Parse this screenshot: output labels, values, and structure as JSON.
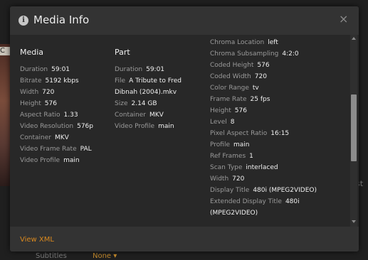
{
  "background": {
    "left_fragment": "C",
    "right_fragment": "st",
    "bottom_label": "Subtitles",
    "bottom_value": "None"
  },
  "modal": {
    "title": "Media Info",
    "icon": "info-icon",
    "close_glyph": "×",
    "footer_link": "View XML"
  },
  "media": {
    "title": "Media",
    "fields": [
      {
        "label": "Duration",
        "value": "59:01"
      },
      {
        "label": "Bitrate",
        "value": "5192 kbps"
      },
      {
        "label": "Width",
        "value": "720"
      },
      {
        "label": "Height",
        "value": "576"
      },
      {
        "label": "Aspect Ratio",
        "value": "1.33"
      },
      {
        "label": "Video Resolution",
        "value": "576p"
      },
      {
        "label": "Container",
        "value": "MKV"
      },
      {
        "label": "Video Frame Rate",
        "value": "PAL"
      },
      {
        "label": "Video Profile",
        "value": "main"
      }
    ]
  },
  "part": {
    "title": "Part",
    "fields": [
      {
        "label": "Duration",
        "value": "59:01"
      },
      {
        "label": "File",
        "value": "A Tribute to Fred Dibnah (2004).mkv"
      },
      {
        "label": "Size",
        "value": "2.14 GB"
      },
      {
        "label": "Container",
        "value": "MKV"
      },
      {
        "label": "Video Profile",
        "value": "main"
      }
    ]
  },
  "stream": {
    "fields": [
      {
        "label": "Chroma Location",
        "value": "left"
      },
      {
        "label": "Chroma Subsampling",
        "value": "4:2:0"
      },
      {
        "label": "Coded Height",
        "value": "576"
      },
      {
        "label": "Coded Width",
        "value": "720"
      },
      {
        "label": "Color Range",
        "value": "tv"
      },
      {
        "label": "Frame Rate",
        "value": "25 fps"
      },
      {
        "label": "Height",
        "value": "576"
      },
      {
        "label": "Level",
        "value": "8"
      },
      {
        "label": "Pixel Aspect Ratio",
        "value": "16:15"
      },
      {
        "label": "Profile",
        "value": "main"
      },
      {
        "label": "Ref Frames",
        "value": "1"
      },
      {
        "label": "Scan Type",
        "value": "interlaced"
      },
      {
        "label": "Width",
        "value": "720"
      },
      {
        "label": "Display Title",
        "value": "480i (MPEG2VIDEO)"
      },
      {
        "label": "Extended Display Title",
        "value": "480i (MPEG2VIDEO)"
      }
    ]
  },
  "colors": {
    "accent": "#d9891f",
    "modal_bg": "#282828",
    "header_bg": "#333333",
    "label": "#9a9a9a",
    "value": "#f0f0f0"
  }
}
